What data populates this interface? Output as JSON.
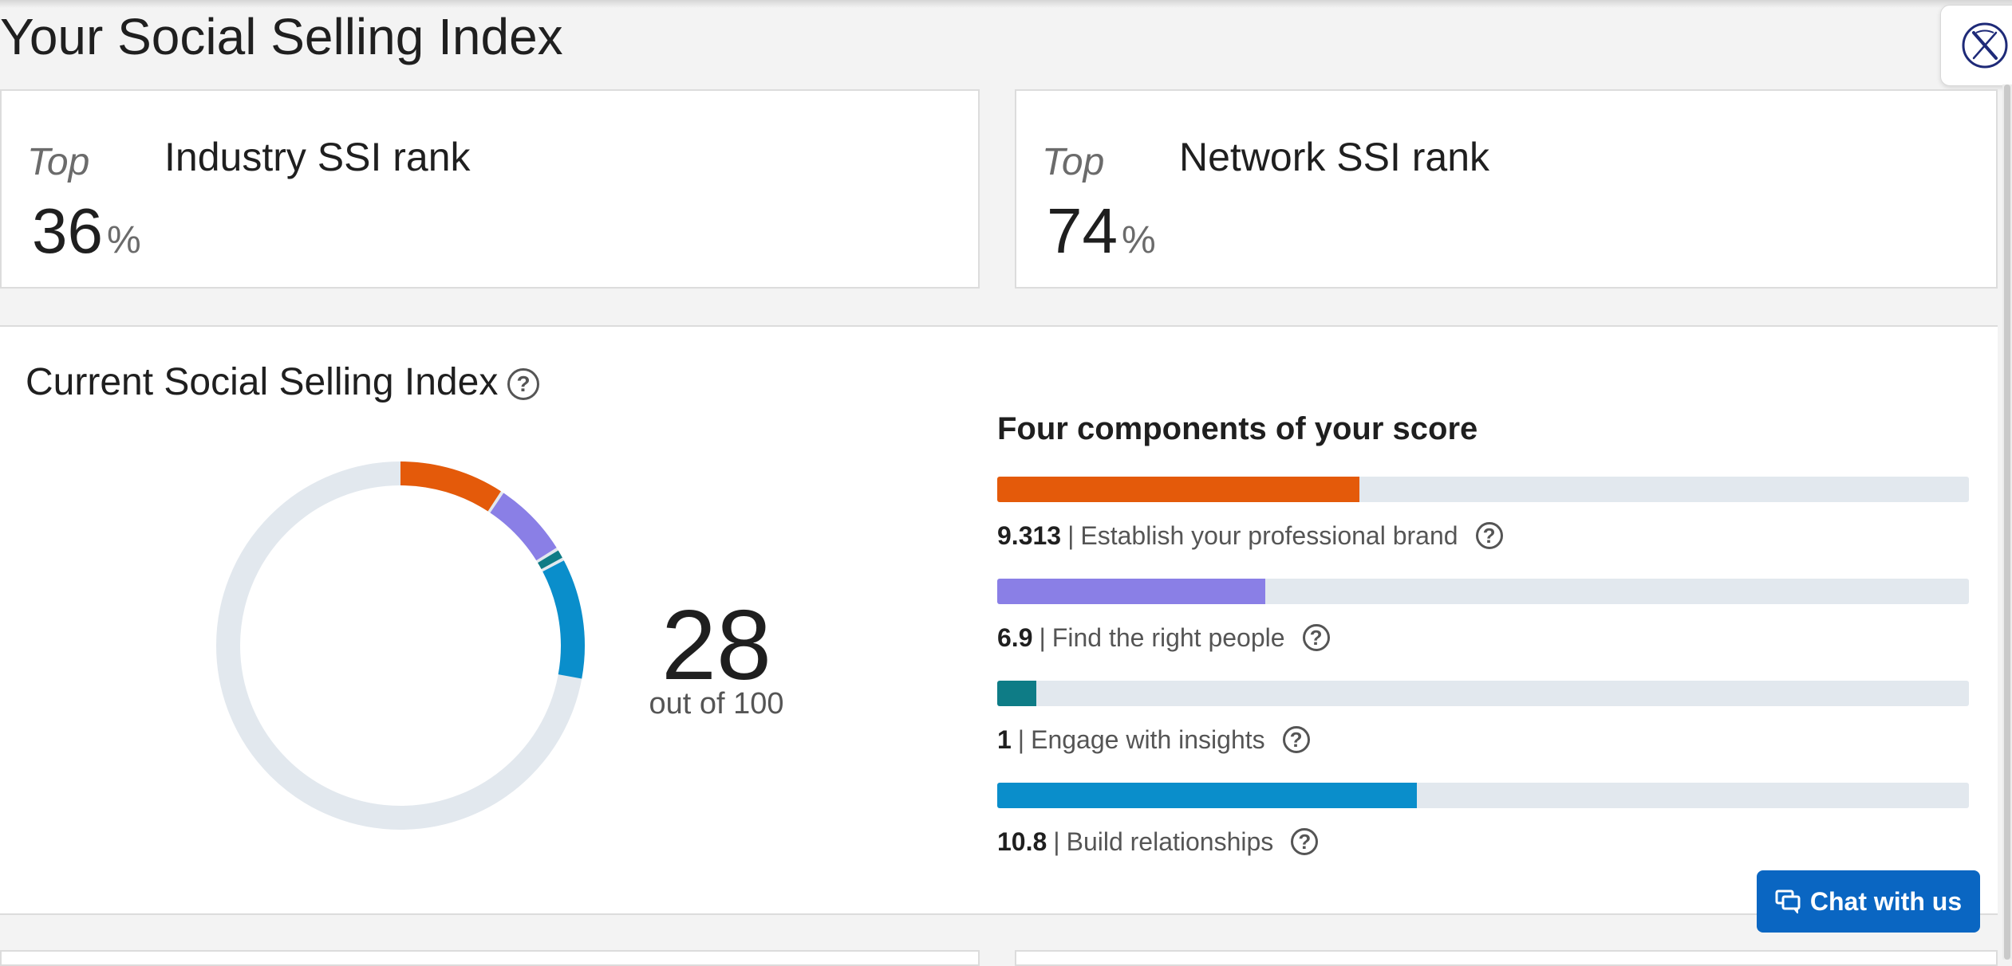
{
  "page": {
    "title": "Your Social Selling Index"
  },
  "close_tab": {
    "icon": "x-logo-icon"
  },
  "ranks": {
    "industry": {
      "top_label": "Top",
      "value": "36",
      "percent": "%",
      "title": "Industry SSI rank"
    },
    "network": {
      "top_label": "Top",
      "value": "74",
      "percent": "%",
      "title": "Network SSI rank"
    }
  },
  "ssi": {
    "title": "Current Social Selling Index",
    "help_icon": "question-circle-icon",
    "score": "28",
    "score_suffix": "out of 100",
    "score_value": 28,
    "score_max": 100
  },
  "components": {
    "title": "Four components of your score",
    "max_per_component": 25,
    "items": [
      {
        "value": "9.313",
        "label": "Establish your professional brand",
        "amount": 9.313,
        "color": "#e45a0a"
      },
      {
        "value": "6.9",
        "label": "Find the right people",
        "amount": 6.9,
        "color": "#8a7fe6"
      },
      {
        "value": "1",
        "label": "Engage with insights",
        "amount": 1,
        "color": "#0e7c86"
      },
      {
        "value": "10.8",
        "label": "Build relationships",
        "amount": 10.8,
        "color": "#0a8ecb"
      }
    ]
  },
  "colors": {
    "track": "#e2e8ee",
    "accent_button": "#0a66c2"
  },
  "chat": {
    "label": "Chat with us",
    "icon": "chat-bubbles-icon"
  }
}
